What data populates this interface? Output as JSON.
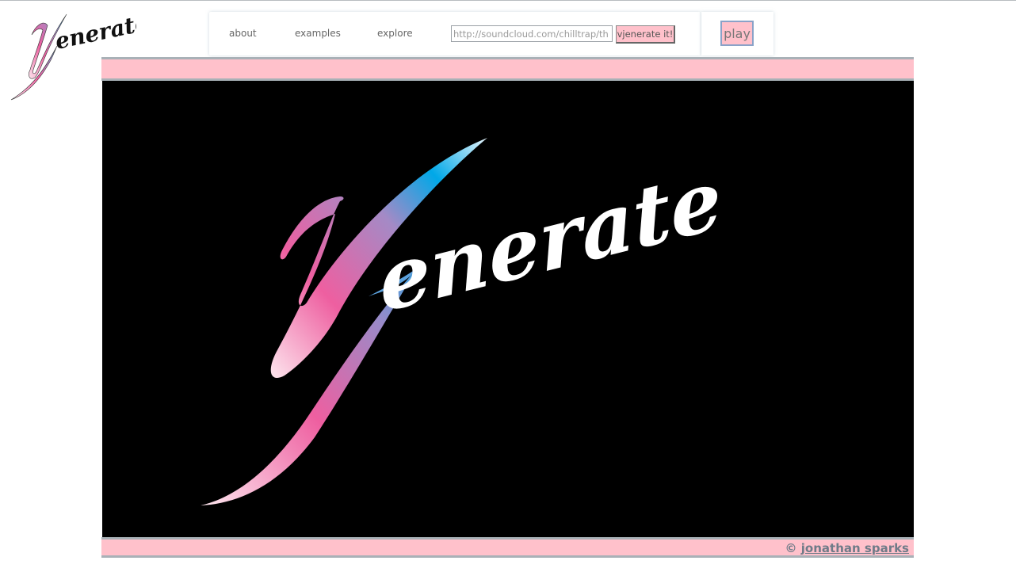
{
  "logo": {
    "text": "enerate"
  },
  "nav": {
    "links": [
      "about",
      "examples",
      "explore"
    ]
  },
  "search": {
    "placeholder": "http://soundcloud.com/chilltrap/th",
    "button_label": "vjenerate it!"
  },
  "player": {
    "play_label": "play"
  },
  "stage": {
    "logo_text": "enerate"
  },
  "footer": {
    "copyright_symbol": "©",
    "author_link": "jonathan sparks"
  },
  "colors": {
    "pink": "#ffc1cb",
    "stage_bg": "#000000",
    "accent_blue": "#00a8e8",
    "accent_pink": "#ee5fa0"
  }
}
